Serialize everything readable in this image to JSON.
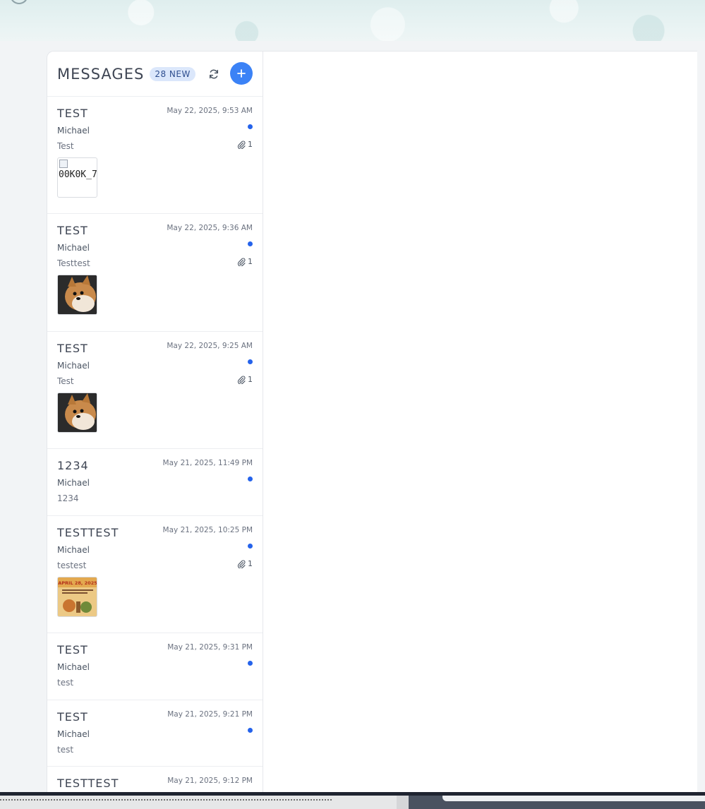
{
  "colors": {
    "accent": "#3b82f6",
    "unread_dot": "#2563eb",
    "badge_bg": "#dbe7fb"
  },
  "list": {
    "title": "MESSAGES",
    "new_badge": "28 NEW",
    "refresh_icon": "refresh-icon",
    "compose_icon": "plus-icon"
  },
  "messages": [
    {
      "subject": "TEST",
      "date": "May 22, 2025, 9:53 AM",
      "sender": "Michael",
      "preview": "Test",
      "attachments": "1",
      "thumb_alt": "00K0K_7",
      "thumb_kind": "broken"
    },
    {
      "subject": "TEST",
      "date": "May 22, 2025, 9:36 AM",
      "sender": "Michael",
      "preview": "Testtest",
      "attachments": "1",
      "thumb_kind": "dog"
    },
    {
      "subject": "TEST",
      "date": "May 22, 2025, 9:25 AM",
      "sender": "Michael",
      "preview": "Test",
      "attachments": "1",
      "thumb_kind": "dog"
    },
    {
      "subject": "1234",
      "date": "May 21, 2025, 11:49 PM",
      "sender": "Michael",
      "preview": "1234"
    },
    {
      "subject": "TESTTEST",
      "date": "May 21, 2025, 10:25 PM",
      "sender": "Michael",
      "preview": "testest",
      "attachments": "1",
      "thumb_kind": "flyer",
      "flyer_text": "APRIL 28, 2025"
    },
    {
      "subject": "TEST",
      "date": "May 21, 2025, 9:31 PM",
      "sender": "Michael",
      "preview": "test"
    },
    {
      "subject": "TEST",
      "date": "May 21, 2025, 9:21 PM",
      "sender": "Michael",
      "preview": "test"
    },
    {
      "subject": "TESTTEST",
      "date": "May 21, 2025, 9:12 PM"
    }
  ]
}
